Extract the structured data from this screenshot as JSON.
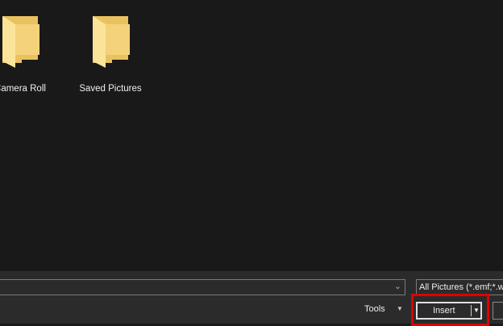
{
  "folders": [
    {
      "name": "Camera Roll"
    },
    {
      "name": "Saved Pictures"
    }
  ],
  "file_name": {
    "value": ""
  },
  "filter": {
    "selected": "All Pictures (*.emf;*.wmf"
  },
  "buttons": {
    "tools": "Tools",
    "insert": "Insert"
  },
  "colors": {
    "highlight": "#e00000",
    "folder": "#f3d27a"
  }
}
